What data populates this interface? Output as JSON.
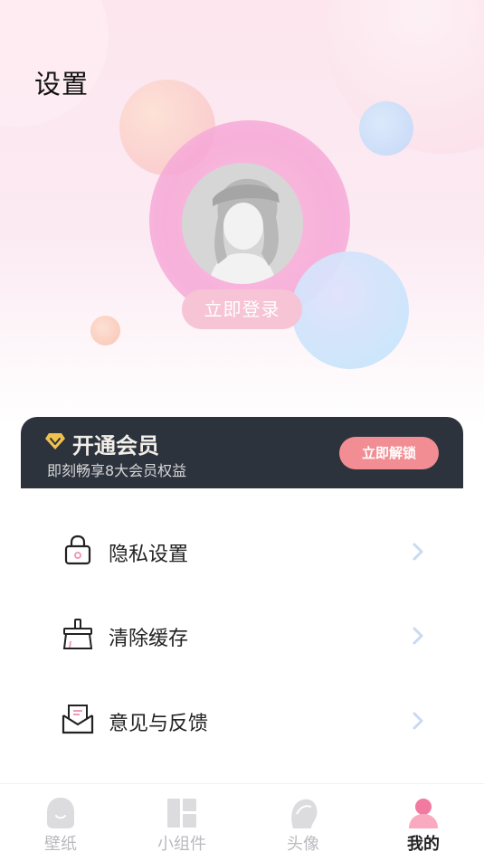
{
  "page": {
    "title": "设置"
  },
  "profile": {
    "login_label": "立即登录"
  },
  "vip": {
    "title": "开通会员",
    "subtitle": "即刻畅享8大会员权益",
    "button_label": "立即解锁",
    "accent": "#f28e93"
  },
  "menu": {
    "items": [
      {
        "label": "隐私设置",
        "icon": "lock-icon"
      },
      {
        "label": "清除缓存",
        "icon": "broom-icon"
      },
      {
        "label": "意见与反馈",
        "icon": "mail-icon"
      }
    ]
  },
  "tabbar": {
    "tabs": [
      {
        "label": "壁纸",
        "icon": "wallpaper-icon",
        "active": false
      },
      {
        "label": "小组件",
        "icon": "widget-icon",
        "active": false
      },
      {
        "label": "头像",
        "icon": "avatar-head-icon",
        "active": false
      },
      {
        "label": "我的",
        "icon": "profile-icon",
        "active": true
      }
    ],
    "active_color": "#f27aa0",
    "inactive_color": "#dcdcdf"
  }
}
